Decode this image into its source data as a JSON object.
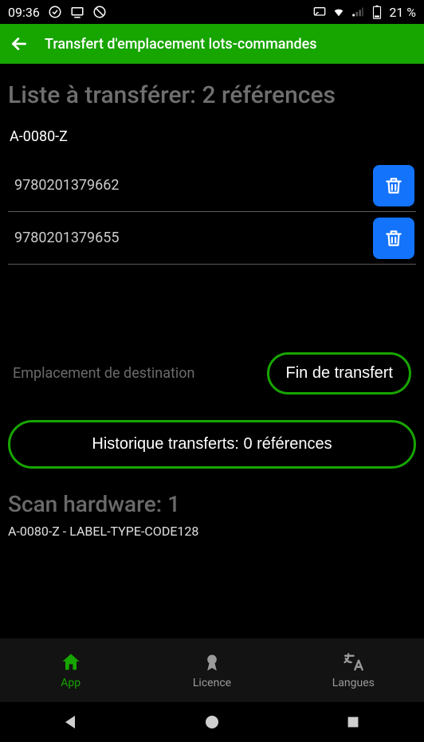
{
  "statusbar": {
    "time": "09:36",
    "battery": "21 %"
  },
  "appbar": {
    "title": "Transfert d'emplacement lots-commandes"
  },
  "list": {
    "title": "Liste à transférer: 2 références",
    "location": "A-0080-Z",
    "items": [
      {
        "code": "9780201379662"
      },
      {
        "code": "9780201379655"
      }
    ]
  },
  "controls": {
    "destination_label": "Emplacement de destination",
    "end_transfer": "Fin de transfert",
    "history": "Historique transferts: 0 références"
  },
  "scan": {
    "title": "Scan hardware: 1",
    "detail": "A-0080-Z - LABEL-TYPE-CODE128"
  },
  "tabs": {
    "app": "App",
    "licence": "Licence",
    "langues": "Langues"
  }
}
